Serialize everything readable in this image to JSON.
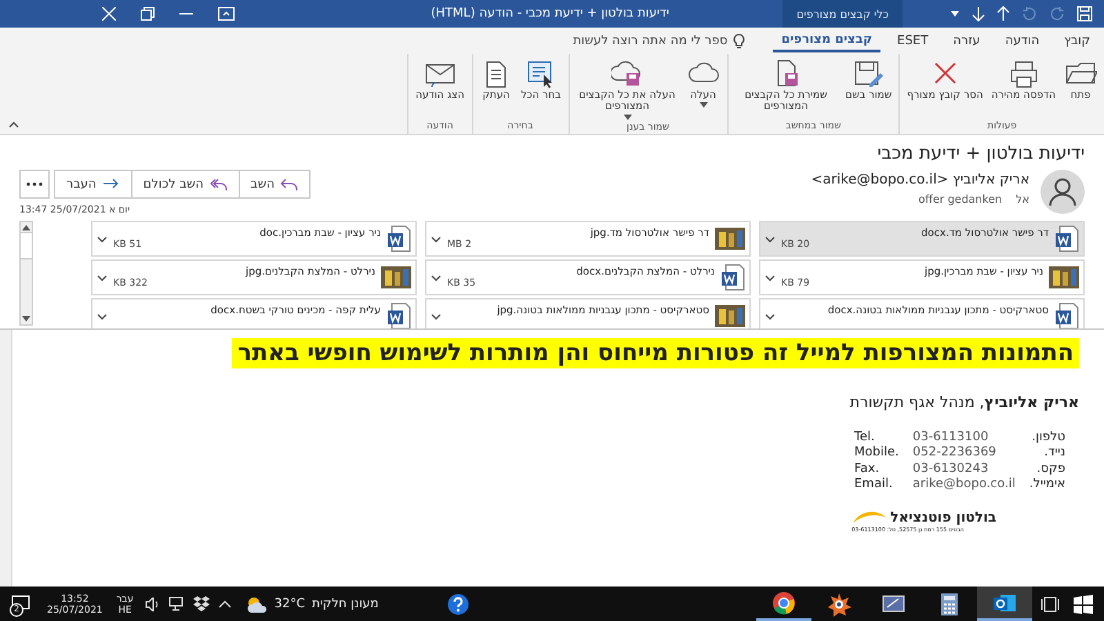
{
  "title_bar": {
    "title": "ידיעות בולטון + ידיעת מכבי  -  הודעה (HTML)",
    "contextual_tab": "כלי קבצים מצורפים"
  },
  "ribbon_tabs": [
    {
      "label": "קובץ",
      "selected": false
    },
    {
      "label": "הודעה",
      "selected": false
    },
    {
      "label": "עזרה",
      "selected": false
    },
    {
      "label": "ESET",
      "selected": false
    },
    {
      "label": "קבצים מצורפים",
      "selected": true
    }
  ],
  "tell_me": "ספר לי מה אתה רוצה לעשות",
  "ribbon_groups": [
    {
      "label": "פעולות",
      "commands": [
        {
          "label": "פתח",
          "dropdown": false
        },
        {
          "label": "הדפסה מהירה",
          "dropdown": false
        },
        {
          "label": "הסר קובץ מצורף",
          "dropdown": false
        }
      ]
    },
    {
      "label": "שמור במחשב",
      "commands": [
        {
          "label": "שמור בשם",
          "dropdown": false
        },
        {
          "label": "שמירת כל הקבצים המצורפים",
          "dropdown": false
        }
      ]
    },
    {
      "label": "שמור בענן",
      "commands": [
        {
          "label": "העלה",
          "dropdown": true
        },
        {
          "label": "העלה את כל הקבצים המצורפים",
          "dropdown": true
        }
      ]
    },
    {
      "label": "בחירה",
      "commands": [
        {
          "label": "בחר הכל",
          "dropdown": false
        },
        {
          "label": "העתק",
          "dropdown": false
        }
      ]
    },
    {
      "label": "הודעה",
      "commands": [
        {
          "label": "הצג הודעה",
          "dropdown": false
        }
      ]
    }
  ],
  "message": {
    "subject": "ידיעות בולטון + ידיעת מכבי",
    "sender": "אריק אליוביץ <arike@bopo.co.il>",
    "to_label": "אל",
    "recipient": "offer gedanken",
    "date": "יום א 25/07/2021 13:47",
    "actions": [
      {
        "label": "השב"
      },
      {
        "label": "השב לכולם"
      },
      {
        "label": "העבר"
      }
    ]
  },
  "attachments": [
    {
      "name": "דר פישר אולטרסול מד.docx",
      "size": "20 KB",
      "kind": "word",
      "selected": true
    },
    {
      "name": "דר פישר אולטרסול מד.jpg",
      "size": "2 MB",
      "kind": "image",
      "selected": false
    },
    {
      "name": "ניר עציון - שבת מברכין.doc",
      "size": "51 KB",
      "kind": "word",
      "selected": false
    },
    {
      "name": "ניר עציון - שבת מברכין.jpg",
      "size": "79 KB",
      "kind": "image",
      "selected": false
    },
    {
      "name": "נירלט - המלצת הקבלנים.docx",
      "size": "35 KB",
      "kind": "word",
      "selected": false
    },
    {
      "name": "נירלט - המלצת הקבלנים.jpg",
      "size": "322 KB",
      "kind": "image",
      "selected": false
    },
    {
      "name": "סטארקיסט - מתכון עגבניות ממולאות בטונה.docx",
      "kind": "word",
      "selected": false
    },
    {
      "name": "סטארקיסט - מתכון עגבניות ממולאות בטונה.jpg",
      "kind": "image",
      "selected": false
    },
    {
      "name": "עלית קפה - מכינים טורקי בשטח.docx",
      "kind": "word",
      "selected": false
    }
  ],
  "body": {
    "banner": "התמונות המצורפות למייל זה פטורות מייחוס והן מותרות לשימוש חופשי באתר",
    "signature": "**אריק אליוביץ**, מנהל אגף תקשורת",
    "contacts": [
      {
        "label_he": "טלפון.",
        "value": "03-6113100",
        "label_en": "Tel."
      },
      {
        "label_he": "נייד.",
        "value": "052-2236369",
        "label_en": "Mobile."
      },
      {
        "label_he": "פקס.",
        "value": "03-6130243",
        "label_en": "Fax."
      },
      {
        "label_he": "אימייל.",
        "value": "arike@bopo.co.il",
        "label_en": "Email."
      }
    ],
    "logo": {
      "name": "בולטון פוטנציאל",
      "address": "הבונים 155 רמת גן 52575, טל: 03-6113100"
    }
  },
  "taskbar": {
    "notifications": "2",
    "time": "13:52",
    "date": "25/07/2021",
    "language": [
      "עבר",
      "HE"
    ],
    "weather": {
      "temperature": "32°C",
      "condition": "מעונן חלקית"
    },
    "apps": [
      {
        "running": true,
        "selected": false
      },
      {
        "running": false,
        "selected": false
      },
      {
        "running": false,
        "selected": false
      },
      {
        "running": false,
        "selected": false
      },
      {
        "running": true,
        "selected": true
      }
    ]
  }
}
